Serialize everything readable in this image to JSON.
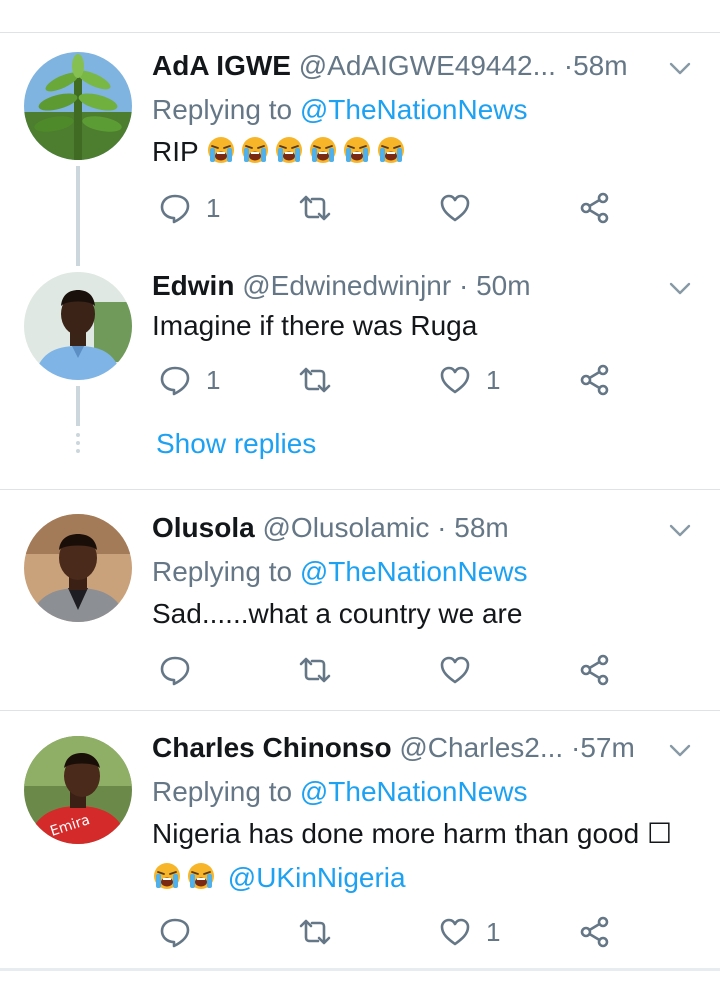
{
  "tweets": [
    {
      "name": "AdA IGWE",
      "handle": "@AdAIGWE49442...",
      "separator": "·",
      "time": "58m",
      "replying_prefix": "Replying to ",
      "replying_to": "@TheNationNews",
      "text": "RIP",
      "reply_count": "1",
      "like_count": ""
    },
    {
      "name": "Edwin",
      "handle": "@Edwinedwinjnr",
      "separator": "·",
      "time": "50m",
      "text": "Imagine if there was Ruga",
      "reply_count": "1",
      "like_count": "1",
      "show_replies": "Show replies"
    },
    {
      "name": "Olusola",
      "handle": "@Olusolamic",
      "separator": "·",
      "time": "58m",
      "replying_prefix": "Replying to ",
      "replying_to": "@TheNationNews",
      "text": "Sad......what a country we are",
      "reply_count": "",
      "like_count": ""
    },
    {
      "name": "Charles Chinonso",
      "handle": "@Charles2...",
      "separator": "·",
      "time": "57m",
      "replying_prefix": "Replying to ",
      "replying_to": "@TheNationNews",
      "text": "Nigeria has done more harm than good ☐",
      "mention": "@UKinNigeria",
      "reply_count": "",
      "like_count": "1"
    }
  ],
  "icons": {
    "reply": "reply-icon",
    "retweet": "retweet-icon",
    "like": "heart-icon",
    "share": "share-icon",
    "more": "chevron-down-icon",
    "emoji": "loudly-crying-face-emoji"
  },
  "colors": {
    "link": "#1da1f2",
    "secondary_text": "#657786",
    "primary_text": "#14171a",
    "divider": "#dfe3e6",
    "thread_line": "#ccd6dd",
    "emoji": "#f7b52a"
  }
}
